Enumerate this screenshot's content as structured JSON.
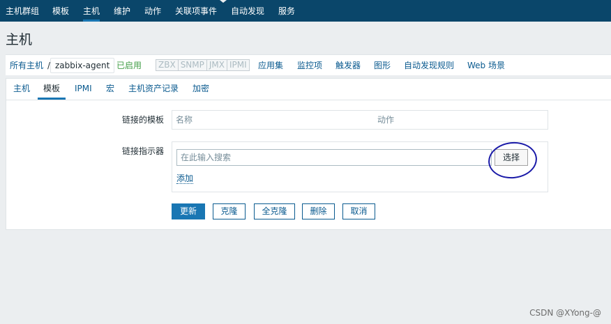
{
  "topnav": {
    "items": [
      "主机群组",
      "模板",
      "主机",
      "维护",
      "动作",
      "关联项事件",
      "自动发现",
      "服务"
    ],
    "active_index": 2
  },
  "page": {
    "title": "主机"
  },
  "breadcrumb": {
    "all_hosts": "所有主机",
    "separator": "/",
    "host_name": "zabbix-agent",
    "status": "已启用",
    "availability": [
      "ZBX",
      "SNMP",
      "JMX",
      "IPMI"
    ],
    "links": [
      "应用集",
      "监控项",
      "触发器",
      "图形",
      "自动发现规则",
      "Web 场景"
    ]
  },
  "tabs": {
    "items": [
      "主机",
      "模板",
      "IPMI",
      "宏",
      "主机资产记录",
      "加密"
    ],
    "active_index": 1
  },
  "form": {
    "linked_templates_label": "链接的模板",
    "table_headers": [
      "名称",
      "动作"
    ],
    "link_new_label": "链接指示器",
    "search_placeholder": "在此输入搜索",
    "select_button": "选择",
    "add_link": "添加"
  },
  "buttons": {
    "update": "更新",
    "clone": "克隆",
    "full_clone": "全克隆",
    "delete": "删除",
    "cancel": "取消"
  },
  "watermark": "CSDN @XYong-@",
  "colors": {
    "nav_bg": "#0a466a",
    "accent": "#1976b3",
    "link": "#0a5a8f",
    "enabled": "#429e47",
    "annotation": "#1a1aa8"
  }
}
